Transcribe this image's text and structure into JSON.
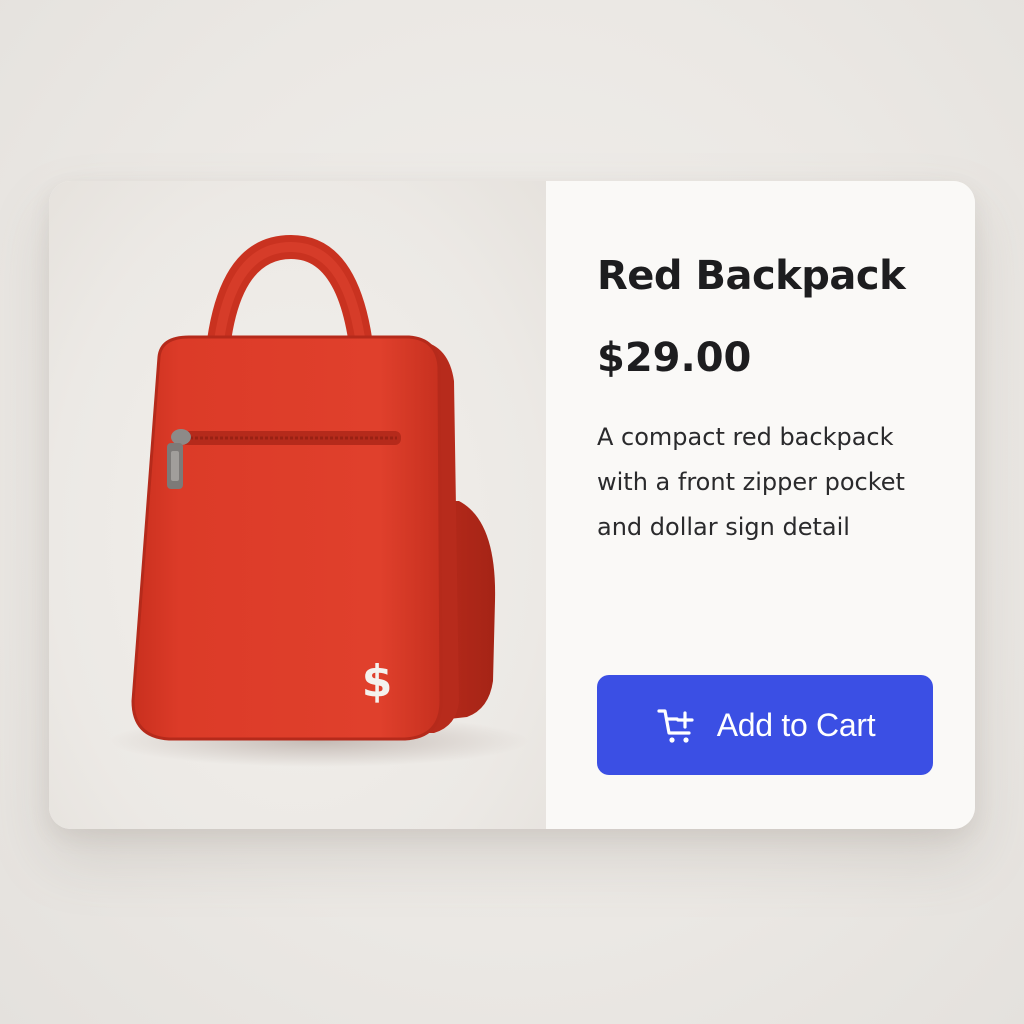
{
  "product": {
    "title": "Red Backpack",
    "price": "$29.00",
    "description": "A compact red backpack with a front zipper pocket and dollar sign detail",
    "image_icon": "red-backpack-image",
    "badge_symbol": "$"
  },
  "actions": {
    "add_to_cart_label": "Add to Cart",
    "add_to_cart_icon": "cart-plus-icon"
  },
  "colors": {
    "accent": "#3b4fe4",
    "product": "#d93a2b"
  }
}
